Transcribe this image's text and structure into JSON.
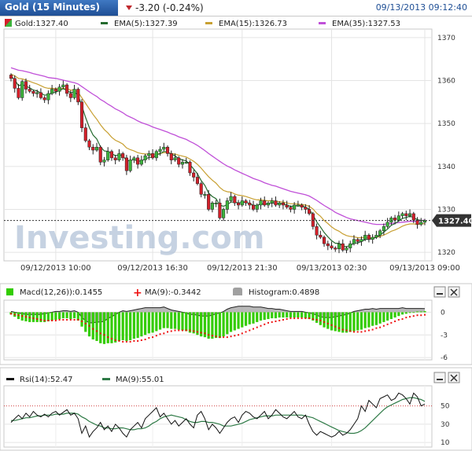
{
  "header": {
    "title": "Gold (15 Minutes)",
    "change": "-3.20 (-0.24%)",
    "datetime": "09/13/2013 09:12:40"
  },
  "watermark": "Investing.com",
  "colors": {
    "bull": "#3cb43c",
    "bear": "#d4202a",
    "ema5": "#246b2e",
    "ema15": "#c8a032",
    "ema35": "#c050d8",
    "macd": "#33cc00",
    "macd_ma": "#ee1111",
    "histogram": "#a0a0a0",
    "rsi": "#111111",
    "rsi_ma": "#2e7a46",
    "accent": "#1f4f95"
  },
  "chart_data": [
    {
      "type": "candlestick",
      "title": "Gold (15 Minutes)",
      "legend": [
        {
          "key": "price",
          "label": "Gold:1327.40"
        },
        {
          "key": "ema5",
          "label": "EMA(5):1327.39"
        },
        {
          "key": "ema15",
          "label": "EMA(15):1326.73"
        },
        {
          "key": "ema35",
          "label": "EMA(35):1327.53"
        }
      ],
      "current_price": 1327.4,
      "current_price_label": "1327.40",
      "ylim": [
        1318,
        1372
      ],
      "y_ticks": [
        1320,
        1330,
        1340,
        1350,
        1360,
        1370
      ],
      "x_tick_labels": [
        "09/12/2013 10:00",
        "09/12/2013 16:30",
        "09/12/2013 21:30",
        "09/13/2013 02:30",
        "09/13/2013 09:00"
      ],
      "x_tick_bars": [
        12,
        38,
        62,
        86,
        111
      ],
      "close": [
        1360.5,
        1358.2,
        1356.0,
        1359.8,
        1358.0,
        1357.5,
        1357.0,
        1357.2,
        1356.0,
        1355.5,
        1357.0,
        1358.0,
        1357.5,
        1358.5,
        1359.0,
        1357.0,
        1356.0,
        1358.0,
        1355.0,
        1349.0,
        1346.0,
        1344.5,
        1343.8,
        1344.5,
        1341.0,
        1341.5,
        1343.5,
        1342.0,
        1341.5,
        1343.0,
        1342.0,
        1339.0,
        1341.5,
        1342.0,
        1340.5,
        1341.5,
        1342.5,
        1343.0,
        1342.0,
        1343.5,
        1344.0,
        1344.5,
        1343.0,
        1341.5,
        1342.0,
        1340.5,
        1341.0,
        1341.0,
        1338.5,
        1337.5,
        1336.0,
        1333.5,
        1333.5,
        1330.0,
        1331.5,
        1331.5,
        1328.0,
        1330.0,
        1332.0,
        1333.0,
        1331.5,
        1331.0,
        1332.0,
        1331.5,
        1331.0,
        1330.0,
        1331.0,
        1332.0,
        1331.0,
        1331.5,
        1332.0,
        1331.0,
        1331.5,
        1331.0,
        1330.5,
        1330.0,
        1331.0,
        1331.0,
        1330.5,
        1330.0,
        1329.0,
        1326.0,
        1324.0,
        1323.5,
        1322.0,
        1321.5,
        1321.0,
        1320.8,
        1322.0,
        1320.5,
        1321.0,
        1322.0,
        1323.0,
        1322.5,
        1323.0,
        1324.0,
        1323.0,
        1323.5,
        1324.0,
        1325.0,
        1326.0,
        1327.0,
        1328.0,
        1327.5,
        1328.5,
        1329.0,
        1328.5,
        1329.0,
        1327.5,
        1326.5,
        1327.0,
        1327.4
      ],
      "ema5": [
        1361.0,
        1360.2,
        1358.8,
        1359.1,
        1358.7,
        1358.3,
        1357.8,
        1357.6,
        1357.1,
        1356.6,
        1356.7,
        1357.1,
        1357.3,
        1357.7,
        1358.1,
        1357.7,
        1357.2,
        1357.4,
        1356.6,
        1354.1,
        1351.4,
        1349.1,
        1347.3,
        1346.4,
        1344.6,
        1343.6,
        1343.5,
        1343.0,
        1342.5,
        1342.7,
        1342.5,
        1341.3,
        1341.4,
        1341.6,
        1341.2,
        1341.3,
        1341.7,
        1342.1,
        1342.1,
        1342.6,
        1343.0,
        1343.5,
        1343.4,
        1342.8,
        1342.5,
        1341.8,
        1341.5,
        1341.3,
        1340.4,
        1339.4,
        1338.3,
        1336.7,
        1335.6,
        1333.8,
        1333.0,
        1332.5,
        1331.0,
        1330.7,
        1331.1,
        1331.7,
        1331.7,
        1331.5,
        1331.6,
        1331.6,
        1331.4,
        1330.9,
        1330.9,
        1331.3,
        1331.2,
        1331.3,
        1331.5,
        1331.4,
        1331.4,
        1331.3,
        1331.0,
        1330.7,
        1330.8,
        1330.9,
        1330.8,
        1330.5,
        1330.0,
        1328.7,
        1327.1,
        1325.9,
        1324.6,
        1323.6,
        1322.7,
        1322.1,
        1322.1,
        1321.5,
        1321.3,
        1321.6,
        1322.1,
        1322.2,
        1322.5,
        1323.0,
        1323.0,
        1323.2,
        1323.5,
        1324.0,
        1324.7,
        1325.4,
        1326.3,
        1326.7,
        1327.3,
        1327.9,
        1328.1,
        1328.4,
        1328.1,
        1327.6,
        1327.4,
        1327.4
      ],
      "ema15": [
        1361.5,
        1361.1,
        1360.5,
        1360.4,
        1360.1,
        1359.8,
        1359.5,
        1359.2,
        1358.8,
        1358.4,
        1358.2,
        1358.2,
        1358.1,
        1358.1,
        1358.2,
        1358.1,
        1357.8,
        1357.8,
        1357.3,
        1356.0,
        1354.7,
        1353.4,
        1352.1,
        1351.0,
        1349.7,
        1348.6,
        1347.8,
        1346.8,
        1346.1,
        1345.7,
        1345.2,
        1344.3,
        1343.9,
        1343.6,
        1343.2,
        1343.0,
        1342.9,
        1342.9,
        1342.8,
        1342.9,
        1343.0,
        1343.2,
        1343.2,
        1343.0,
        1342.9,
        1342.6,
        1342.4,
        1342.2,
        1341.7,
        1341.2,
        1340.5,
        1339.6,
        1338.6,
        1337.6,
        1336.8,
        1336.1,
        1335.1,
        1334.4,
        1334.1,
        1334.0,
        1333.6,
        1333.3,
        1333.2,
        1333.0,
        1332.7,
        1332.4,
        1332.2,
        1332.2,
        1332.1,
        1332.0,
        1332.0,
        1331.9,
        1331.8,
        1331.7,
        1331.5,
        1331.3,
        1331.3,
        1331.2,
        1331.1,
        1331.0,
        1330.7,
        1330.1,
        1329.1,
        1328.4,
        1327.4,
        1326.7,
        1325.9,
        1325.3,
        1324.9,
        1324.3,
        1323.9,
        1323.7,
        1323.6,
        1323.4,
        1323.4,
        1323.5,
        1323.4,
        1323.4,
        1323.5,
        1323.7,
        1324.0,
        1324.4,
        1324.9,
        1325.2,
        1325.6,
        1326.1,
        1326.4,
        1326.6,
        1326.6,
        1326.5,
        1326.6,
        1326.7
      ],
      "ema35": [
        1363.0,
        1362.7,
        1362.4,
        1362.3,
        1362.1,
        1361.9,
        1361.6,
        1361.4,
        1361.2,
        1361.0,
        1360.7,
        1360.6,
        1360.5,
        1360.3,
        1360.1,
        1359.9,
        1359.7,
        1359.5,
        1359.2,
        1358.6,
        1358.0,
        1357.4,
        1356.8,
        1356.3,
        1355.6,
        1355.1,
        1354.5,
        1354.0,
        1353.4,
        1353.0,
        1352.5,
        1351.9,
        1351.5,
        1351.1,
        1350.6,
        1350.2,
        1349.9,
        1349.6,
        1349.2,
        1348.9,
        1348.6,
        1348.3,
        1348.0,
        1347.6,
        1347.3,
        1346.9,
        1346.6,
        1346.3,
        1345.8,
        1345.4,
        1344.9,
        1344.3,
        1343.7,
        1343.0,
        1342.4,
        1341.8,
        1341.2,
        1340.6,
        1340.1,
        1339.7,
        1339.2,
        1338.8,
        1338.4,
        1338.0,
        1337.6,
        1337.2,
        1336.9,
        1336.6,
        1336.2,
        1335.9,
        1335.6,
        1335.4,
        1335.1,
        1334.8,
        1334.5,
        1334.2,
        1334.0,
        1333.8,
        1333.6,
        1333.4,
        1333.1,
        1332.6,
        1332.1,
        1331.5,
        1330.9,
        1330.4,
        1329.9,
        1329.3,
        1328.9,
        1328.5,
        1328.1,
        1327.8,
        1327.6,
        1327.4,
        1327.2,
        1327.0,
        1326.8,
        1326.6,
        1326.5,
        1326.5,
        1326.5,
        1326.6,
        1326.7,
        1326.8,
        1326.9,
        1327.0,
        1327.1,
        1327.2,
        1327.2,
        1327.2,
        1327.4,
        1327.5
      ]
    },
    {
      "type": "bar",
      "title": "MACD",
      "legend": [
        {
          "key": "macd",
          "label": "Macd(12,26)):0.1455"
        },
        {
          "key": "ma",
          "label": "MA(9):-0.3442"
        },
        {
          "key": "hist",
          "label": "Histogram:0.4898"
        }
      ],
      "ylim": [
        -6.3,
        1.6
      ],
      "y_ticks": [
        0,
        -3,
        -6
      ],
      "macd": [
        -0.3,
        -0.6,
        -0.9,
        -1.1,
        -1.2,
        -1.3,
        -1.3,
        -1.3,
        -1.3,
        -1.3,
        -1.2,
        -1.1,
        -1.0,
        -0.9,
        -0.8,
        -0.8,
        -0.9,
        -0.8,
        -1.1,
        -1.9,
        -2.6,
        -3.2,
        -3.6,
        -3.8,
        -4.1,
        -4.2,
        -4.1,
        -4.1,
        -4.0,
        -3.8,
        -3.7,
        -3.8,
        -3.7,
        -3.5,
        -3.4,
        -3.2,
        -3.0,
        -2.8,
        -2.7,
        -2.5,
        -2.3,
        -2.1,
        -2.1,
        -2.2,
        -2.2,
        -2.3,
        -2.4,
        -2.5,
        -2.7,
        -2.8,
        -3.0,
        -3.2,
        -3.3,
        -3.5,
        -3.5,
        -3.4,
        -3.4,
        -3.2,
        -2.9,
        -2.6,
        -2.4,
        -2.2,
        -2.0,
        -1.8,
        -1.6,
        -1.5,
        -1.3,
        -1.1,
        -1.0,
        -0.9,
        -0.8,
        -0.8,
        -0.7,
        -0.7,
        -0.7,
        -0.7,
        -0.7,
        -0.7,
        -0.7,
        -0.8,
        -0.9,
        -1.1,
        -1.4,
        -1.7,
        -2.0,
        -2.2,
        -2.4,
        -2.5,
        -2.6,
        -2.7,
        -2.7,
        -2.6,
        -2.5,
        -2.4,
        -2.3,
        -2.1,
        -2.0,
        -1.8,
        -1.7,
        -1.5,
        -1.3,
        -1.1,
        -0.9,
        -0.7,
        -0.5,
        -0.3,
        -0.2,
        -0.1,
        0.0,
        0.1,
        0.1,
        0.15
      ],
      "ma": [
        -0.2,
        -0.3,
        -0.4,
        -0.5,
        -0.6,
        -0.7,
        -0.8,
        -0.9,
        -1.0,
        -1.1,
        -1.1,
        -1.1,
        -1.1,
        -1.0,
        -1.0,
        -1.0,
        -1.0,
        -1.0,
        -1.0,
        -1.2,
        -1.5,
        -1.8,
        -2.2,
        -2.5,
        -2.8,
        -3.0,
        -3.3,
        -3.5,
        -3.7,
        -3.8,
        -3.9,
        -3.9,
        -3.9,
        -3.8,
        -3.8,
        -3.7,
        -3.6,
        -3.4,
        -3.3,
        -3.1,
        -2.9,
        -2.8,
        -2.6,
        -2.5,
        -2.4,
        -2.4,
        -2.4,
        -2.4,
        -2.4,
        -2.5,
        -2.6,
        -2.7,
        -2.8,
        -3.0,
        -3.1,
        -3.2,
        -3.3,
        -3.3,
        -3.3,
        -3.2,
        -3.1,
        -3.0,
        -2.8,
        -2.6,
        -2.4,
        -2.2,
        -2.0,
        -1.8,
        -1.6,
        -1.4,
        -1.3,
        -1.2,
        -1.1,
        -1.0,
        -0.9,
        -0.8,
        -0.8,
        -0.8,
        -0.8,
        -0.8,
        -0.8,
        -0.9,
        -1.0,
        -1.1,
        -1.3,
        -1.5,
        -1.7,
        -1.9,
        -2.1,
        -2.3,
        -2.4,
        -2.5,
        -2.6,
        -2.6,
        -2.6,
        -2.5,
        -2.4,
        -2.3,
        -2.1,
        -2.0,
        -1.8,
        -1.6,
        -1.4,
        -1.2,
        -1.0,
        -0.9,
        -0.7,
        -0.6,
        -0.5,
        -0.4,
        -0.4,
        -0.34
      ],
      "hist": [
        0.1,
        0.0,
        -0.1,
        -0.2,
        -0.3,
        -0.3,
        -0.3,
        -0.3,
        -0.3,
        -0.2,
        -0.1,
        0.0,
        0.1,
        0.1,
        0.2,
        0.2,
        0.1,
        0.2,
        0.0,
        -0.7,
        -1.1,
        -1.4,
        -1.4,
        -1.3,
        -1.3,
        -1.2,
        -0.8,
        -0.6,
        -0.3,
        0.0,
        0.2,
        0.1,
        0.2,
        0.3,
        0.4,
        0.5,
        0.6,
        0.6,
        0.6,
        0.6,
        0.6,
        0.7,
        0.5,
        0.3,
        0.2,
        0.1,
        0.0,
        -0.1,
        -0.3,
        -0.3,
        -0.4,
        -0.5,
        -0.5,
        -0.5,
        -0.4,
        -0.2,
        -0.1,
        0.1,
        0.4,
        0.6,
        0.7,
        0.8,
        0.8,
        0.8,
        0.8,
        0.7,
        0.7,
        0.7,
        0.6,
        0.5,
        0.5,
        0.4,
        0.4,
        0.3,
        0.2,
        0.1,
        0.1,
        0.1,
        0.1,
        0.0,
        -0.1,
        -0.2,
        -0.4,
        -0.6,
        -0.7,
        -0.7,
        -0.7,
        -0.6,
        -0.5,
        -0.4,
        -0.3,
        -0.1,
        0.1,
        0.2,
        0.3,
        0.4,
        0.4,
        0.5,
        0.4,
        0.5,
        0.5,
        0.5,
        0.5,
        0.5,
        0.5,
        0.6,
        0.5,
        0.5,
        0.5,
        0.5,
        0.5,
        0.49
      ]
    },
    {
      "type": "line",
      "title": "RSI",
      "legend": [
        {
          "key": "rsi",
          "label": "Rsi(14):52.47"
        },
        {
          "key": "ma",
          "label": "MA(9):55.01"
        }
      ],
      "ylim": [
        5,
        72
      ],
      "y_ticks": [
        10,
        30,
        50
      ],
      "overbought": 50,
      "rsi": [
        32,
        36,
        40,
        36,
        42,
        38,
        44,
        40,
        38,
        41,
        38,
        42,
        44,
        40,
        43,
        46,
        40,
        42,
        36,
        20,
        28,
        16,
        22,
        26,
        32,
        24,
        28,
        22,
        30,
        26,
        20,
        16,
        24,
        28,
        32,
        26,
        36,
        40,
        44,
        48,
        38,
        42,
        36,
        30,
        34,
        28,
        32,
        36,
        30,
        26,
        40,
        44,
        36,
        24,
        30,
        26,
        20,
        26,
        32,
        36,
        38,
        32,
        40,
        44,
        42,
        38,
        36,
        40,
        44,
        36,
        40,
        46,
        42,
        38,
        36,
        40,
        44,
        38,
        36,
        40,
        30,
        22,
        18,
        22,
        20,
        18,
        16,
        18,
        22,
        18,
        20,
        24,
        30,
        36,
        50,
        44,
        56,
        52,
        48,
        58,
        60,
        62,
        56,
        58,
        64,
        62,
        58,
        52,
        64,
        60,
        50,
        52
      ],
      "ma": [
        34,
        34,
        35,
        36,
        37,
        37,
        38,
        39,
        39,
        40,
        40,
        40,
        41,
        41,
        41,
        42,
        42,
        42,
        41,
        38,
        36,
        33,
        31,
        29,
        28,
        26,
        26,
        25,
        25,
        26,
        26,
        25,
        24,
        24,
        25,
        25,
        26,
        28,
        31,
        33,
        36,
        38,
        39,
        40,
        39,
        38,
        37,
        35,
        33,
        32,
        32,
        33,
        33,
        32,
        32,
        31,
        30,
        28,
        28,
        28,
        29,
        30,
        31,
        33,
        35,
        36,
        37,
        38,
        39,
        39,
        39,
        40,
        40,
        40,
        40,
        40,
        40,
        40,
        40,
        39,
        38,
        37,
        35,
        33,
        31,
        29,
        27,
        25,
        23,
        22,
        21,
        20,
        20,
        21,
        23,
        26,
        30,
        34,
        38,
        42,
        46,
        49,
        51,
        53,
        55,
        57,
        58,
        59,
        59,
        58,
        57,
        55
      ]
    }
  ]
}
